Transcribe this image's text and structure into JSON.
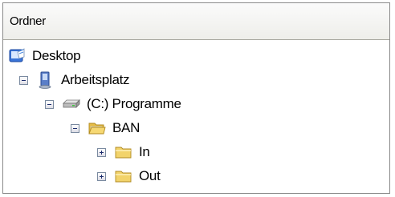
{
  "panel": {
    "header": "Ordner"
  },
  "tree": {
    "desktop": {
      "label": "Desktop",
      "icon": "desktop-icon"
    },
    "computer": {
      "label": "Arbeitsplatz",
      "icon": "computer-icon",
      "expander": "collapse"
    },
    "drive": {
      "label": "(C:) Programme",
      "icon": "drive-icon",
      "expander": "collapse"
    },
    "ban": {
      "label": "BAN",
      "icon": "folder-open-icon",
      "expander": "collapse"
    },
    "in": {
      "label": "In",
      "icon": "folder-icon",
      "expander": "expand"
    },
    "out": {
      "label": "Out",
      "icon": "folder-icon",
      "expander": "expand"
    }
  },
  "colors": {
    "folder": "#f2d36b",
    "expander_border": "#7a8aa0",
    "header_bg": "#eeeeea"
  }
}
